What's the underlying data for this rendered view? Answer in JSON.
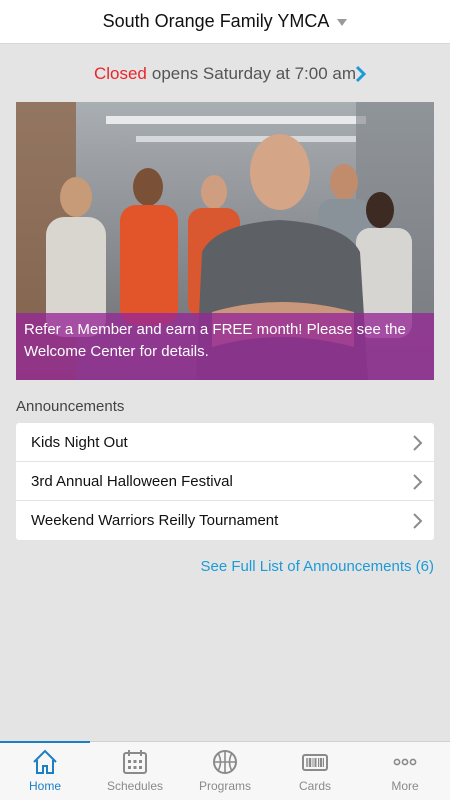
{
  "header": {
    "title": "South Orange Family YMCA"
  },
  "status": {
    "state": "Closed",
    "detail": "opens Saturday at 7:00 am"
  },
  "hero": {
    "caption": "Refer a Member and earn a FREE month!  Please see the Welcome Center for details."
  },
  "announcements": {
    "label": "Announcements",
    "items": [
      {
        "title": "Kids Night Out"
      },
      {
        "title": "3rd Annual Halloween Festival"
      },
      {
        "title": "Weekend Warriors Reilly Tournament"
      }
    ],
    "see_all": "See Full List of Announcements (6)"
  },
  "tabbar": {
    "tabs": [
      {
        "label": "Home",
        "icon": "home-icon"
      },
      {
        "label": "Schedules",
        "icon": "calendar-icon"
      },
      {
        "label": "Programs",
        "icon": "basketball-icon"
      },
      {
        "label": "Cards",
        "icon": "barcode-card-icon"
      },
      {
        "label": "More",
        "icon": "ellipsis-icon"
      }
    ],
    "active": "Home"
  },
  "colors": {
    "accent": "#1b7fc4",
    "closed": "#e8262c",
    "link": "#1b9bd8",
    "banner": "#962896"
  }
}
